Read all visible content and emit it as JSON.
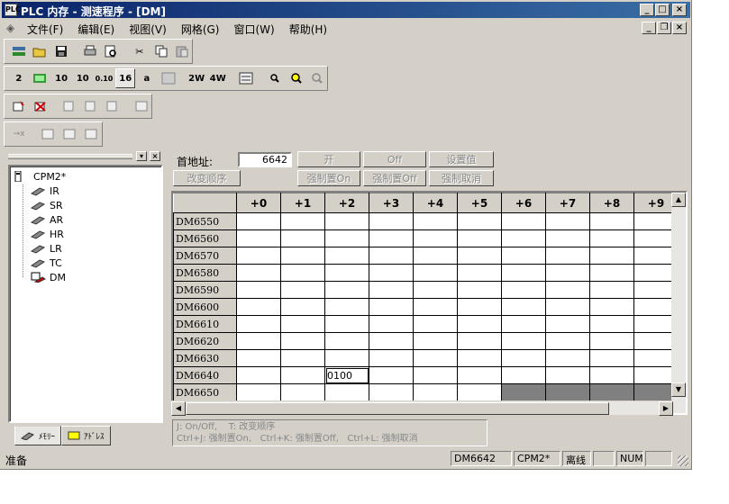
{
  "window": {
    "title": "PLC 内存 - 测速程序 - [DM]",
    "app_icon": "PLC"
  },
  "menu": [
    "文件(F)",
    "编辑(E)",
    "视图(V)",
    "网格(G)",
    "窗口(W)",
    "帮助(H)"
  ],
  "toolbar2_texts": {
    "bits10": "10",
    "bits10b": "10",
    "num010": "0.10",
    "num16": "16",
    "ascii": "a",
    "two_w": "2W",
    "four_w": "4W"
  },
  "tree": {
    "root": "CPM2*",
    "items": [
      "IR",
      "SR",
      "AR",
      "HR",
      "LR",
      "TC",
      "DM"
    ]
  },
  "tabs": [
    "ﾒﾓﾘｰ",
    "ｱﾄﾞﾚｽ"
  ],
  "controls": {
    "start_address_label": "首地址:",
    "start_address_value": "6642",
    "on_button": "开",
    "off_button": "Off",
    "set_value_button": "设置值",
    "change_order_button": "改变顺序",
    "force_on_button": "强制置On",
    "force_off_button": "强制置Off",
    "force_cancel_button": "强制取消"
  },
  "grid": {
    "columns": [
      "+0",
      "+1",
      "+2",
      "+3",
      "+4",
      "+5",
      "+6",
      "+7",
      "+8",
      "+9"
    ],
    "rows": [
      {
        "label": "DM6550",
        "cells": [
          "",
          "",
          "",
          "",
          "",
          "",
          "",
          "",
          "",
          ""
        ]
      },
      {
        "label": "DM6560",
        "cells": [
          "",
          "",
          "",
          "",
          "",
          "",
          "",
          "",
          "",
          ""
        ]
      },
      {
        "label": "DM6570",
        "cells": [
          "",
          "",
          "",
          "",
          "",
          "",
          "",
          "",
          "",
          ""
        ]
      },
      {
        "label": "DM6580",
        "cells": [
          "",
          "",
          "",
          "",
          "",
          "",
          "",
          "",
          "",
          ""
        ]
      },
      {
        "label": "DM6590",
        "cells": [
          "",
          "",
          "",
          "",
          "",
          "",
          "",
          "",
          "",
          ""
        ]
      },
      {
        "label": "DM6600",
        "cells": [
          "",
          "",
          "",
          "",
          "",
          "",
          "",
          "",
          "",
          ""
        ]
      },
      {
        "label": "DM6610",
        "cells": [
          "",
          "",
          "",
          "",
          "",
          "",
          "",
          "",
          "",
          ""
        ]
      },
      {
        "label": "DM6620",
        "cells": [
          "",
          "",
          "",
          "",
          "",
          "",
          "",
          "",
          "",
          ""
        ]
      },
      {
        "label": "DM6630",
        "cells": [
          "",
          "",
          "",
          "",
          "",
          "",
          "",
          "",
          "",
          ""
        ]
      },
      {
        "label": "DM6640",
        "cells": [
          "",
          "",
          "0100",
          "",
          "",
          "",
          "",
          "",
          "",
          ""
        ]
      },
      {
        "label": "DM6650",
        "cells": [
          "",
          "",
          "",
          "",
          "",
          "",
          "",
          "",
          "",
          ""
        ]
      }
    ],
    "selected_address": "DM6642"
  },
  "hint": {
    "line1": "J: On/Off,    T: 改变顺序",
    "line2": "Ctrl+J: 强制置On,   Ctrl+K: 强制置Off,   Ctrl+L: 强制取消"
  },
  "status": {
    "ready": "准备",
    "address": "DM6642",
    "plc": "CPM2*",
    "mode": "离线",
    "num": "NUM"
  },
  "colors": {
    "title_bar": "#0a246a",
    "face": "#d4d0c8",
    "disabled_cells": "#808080"
  }
}
